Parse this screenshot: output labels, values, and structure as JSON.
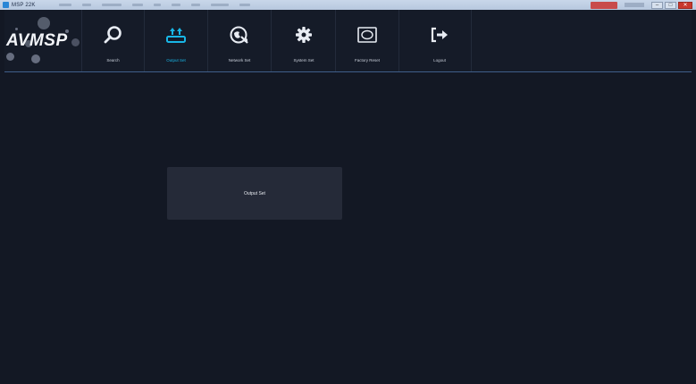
{
  "window": {
    "title": "MSP 22K",
    "close_glyph": "✕",
    "minimize_glyph": "–",
    "maximize_glyph": "□"
  },
  "logo": {
    "text": "AVMSP"
  },
  "toolbar": {
    "items": [
      {
        "label": "Search",
        "icon": "search-icon"
      },
      {
        "label": "Output Set",
        "icon": "output-set-icon",
        "active": true
      },
      {
        "label": "Network Set",
        "icon": "network-icon"
      },
      {
        "label": "System Set",
        "icon": "gear-icon"
      },
      {
        "label": "Factory Reset",
        "icon": "factory-reset-icon"
      },
      {
        "label": "Logout",
        "icon": "logout-icon"
      }
    ]
  },
  "panel": {
    "title": "Output Set"
  },
  "colors": {
    "background": "#131824",
    "toolbar": "#151b28",
    "accent": "#18b6e6",
    "panel": "#252a38"
  }
}
